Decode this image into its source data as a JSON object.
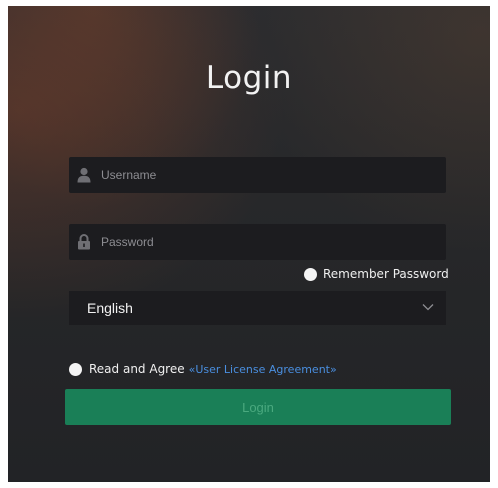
{
  "login": {
    "title": "Login",
    "username": {
      "placeholder": "Username",
      "value": "",
      "icon": "user-icon"
    },
    "password": {
      "placeholder": "Password",
      "value": "",
      "icon": "lock-icon"
    },
    "remember_label": "Remember Password",
    "remember_checked": false,
    "language": {
      "selected": "English",
      "icon": "chevron-down-icon"
    },
    "agreement": {
      "checked": false,
      "text": "Read and Agree",
      "link_text": "«User License Agreement»"
    },
    "login_button_label": "Login"
  },
  "colors": {
    "accent": "#1a7f57",
    "link": "#4a8fe0",
    "field_bg": "#1c1c1f"
  }
}
